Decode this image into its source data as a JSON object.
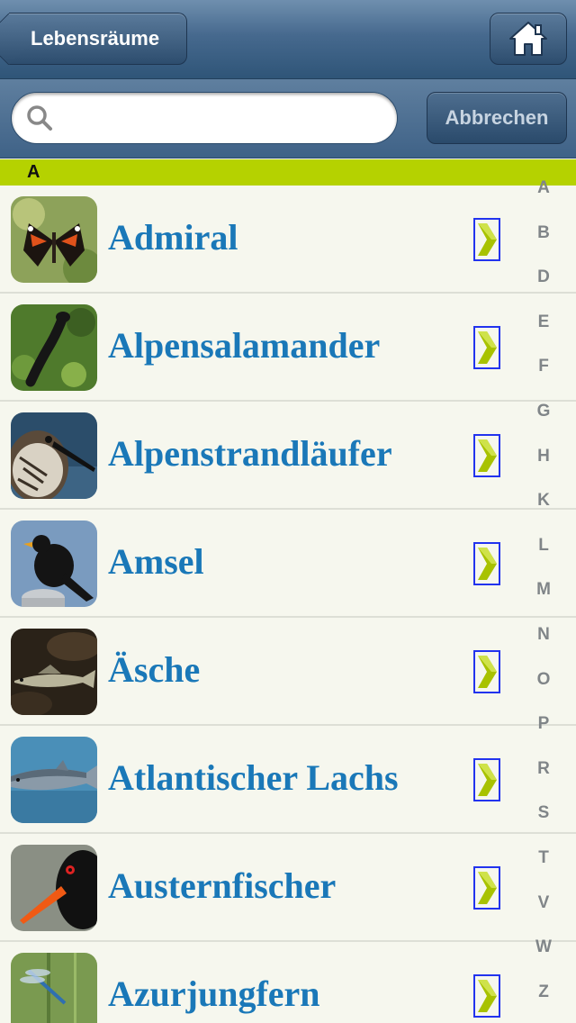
{
  "navbar": {
    "back_label": "Lebensräume",
    "home_icon": "home-icon"
  },
  "search": {
    "value": "",
    "placeholder": "",
    "cancel_label": "Abbrechen"
  },
  "section": {
    "header": "A"
  },
  "items": [
    {
      "label": "Admiral",
      "image": "red-admiral-butterfly"
    },
    {
      "label": "Alpensalamander",
      "image": "alpine-salamander"
    },
    {
      "label": "Alpenstrandläufer",
      "image": "dunlin-bird"
    },
    {
      "label": "Amsel",
      "image": "blackbird"
    },
    {
      "label": "Äsche",
      "image": "grayling-fish"
    },
    {
      "label": "Atlantischer Lachs",
      "image": "atlantic-salmon"
    },
    {
      "label": "Austernfischer",
      "image": "oystercatcher"
    },
    {
      "label": "Azurjungfern",
      "image": "azure-damselfly"
    }
  ],
  "index": [
    "A",
    "B",
    "D",
    "E",
    "F",
    "G",
    "H",
    "K",
    "L",
    "M",
    "N",
    "O",
    "P",
    "R",
    "S",
    "T",
    "V",
    "W",
    "Z"
  ],
  "colors": {
    "section_header": "#b5d200",
    "title_text": "#1a78b8",
    "navbar": "#46698e",
    "chevron": "#a8c200"
  }
}
